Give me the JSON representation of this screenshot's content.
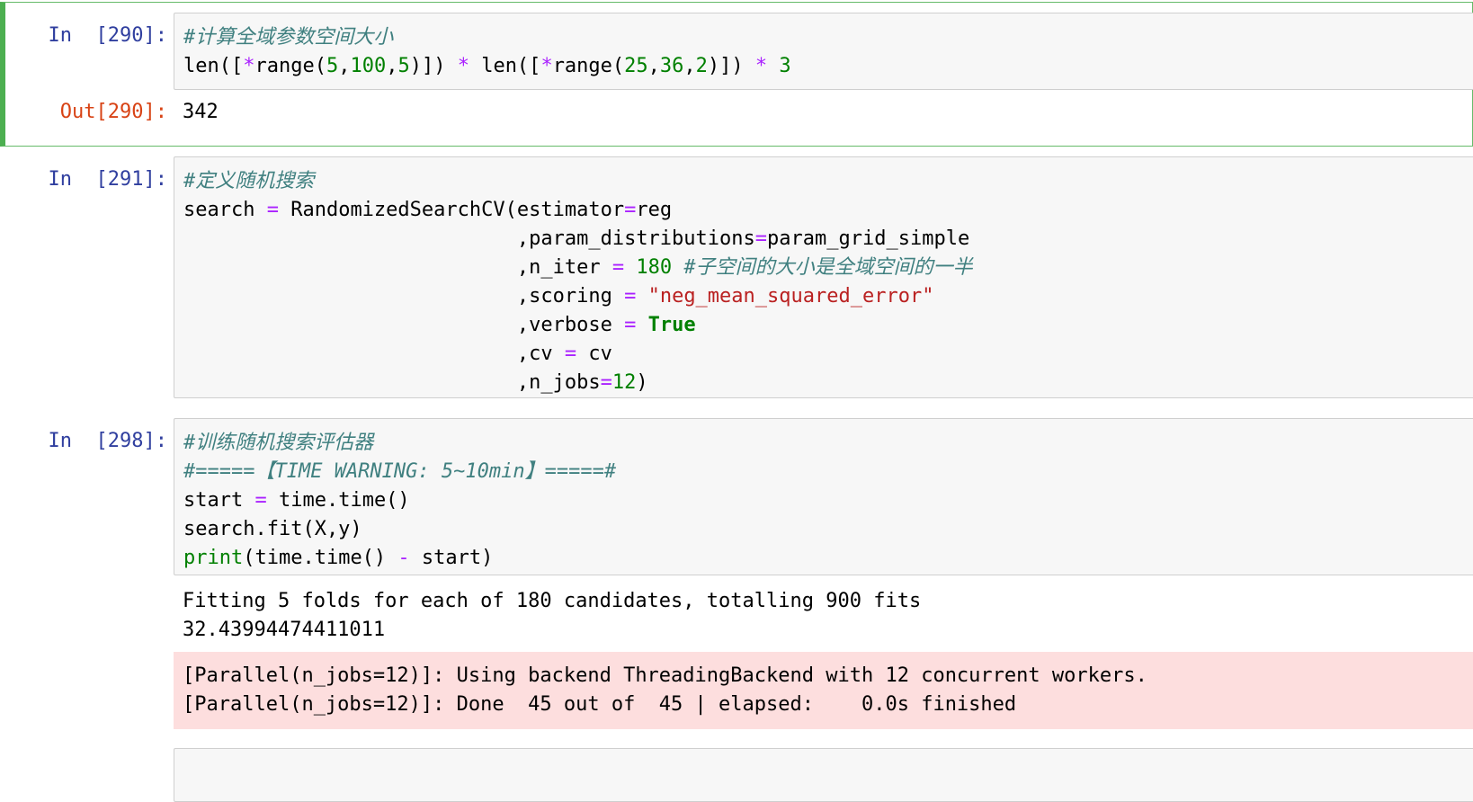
{
  "cells": [
    {
      "prompt_in": "In  [290]:",
      "code_lines": [
        "#计算全域参数空间大小",
        "len([*range(5,100,5)]) * len([*range(25,36,2)]) * 3"
      ],
      "prompt_out": "Out[290]:",
      "output": "342"
    },
    {
      "prompt_in": "In  [291]:",
      "code_lines": [
        "#定义随机搜索",
        "search = RandomizedSearchCV(estimator=reg",
        "                            ,param_distributions=param_grid_simple",
        "                            ,n_iter = 180 #子空间的大小是全域空间的一半",
        "                            ,scoring = \"neg_mean_squared_error\"",
        "                            ,verbose = True",
        "                            ,cv = cv",
        "                            ,n_jobs=12)"
      ]
    },
    {
      "prompt_in": "In  [298]:",
      "code_lines": [
        "#训练随机搜索评估器",
        "#=====【TIME WARNING: 5~10min】=====#",
        "start = time.time()",
        "search.fit(X,y)",
        "print(time.time() - start)"
      ],
      "stdout_lines": [
        "Fitting 5 folds for each of 180 candidates, totalling 900 fits",
        "32.43994474411011"
      ],
      "stderr_lines": [
        "[Parallel(n_jobs=12)]: Using backend ThreadingBackend with 12 concurrent workers.",
        "[Parallel(n_jobs=12)]: Done  45 out of  45 | elapsed:    0.0s finished"
      ]
    }
  ],
  "colors": {
    "prompt_in": "#303f9f",
    "prompt_out": "#d84315",
    "selected_border": "#4caf50",
    "stderr_bg": "#fddede"
  }
}
